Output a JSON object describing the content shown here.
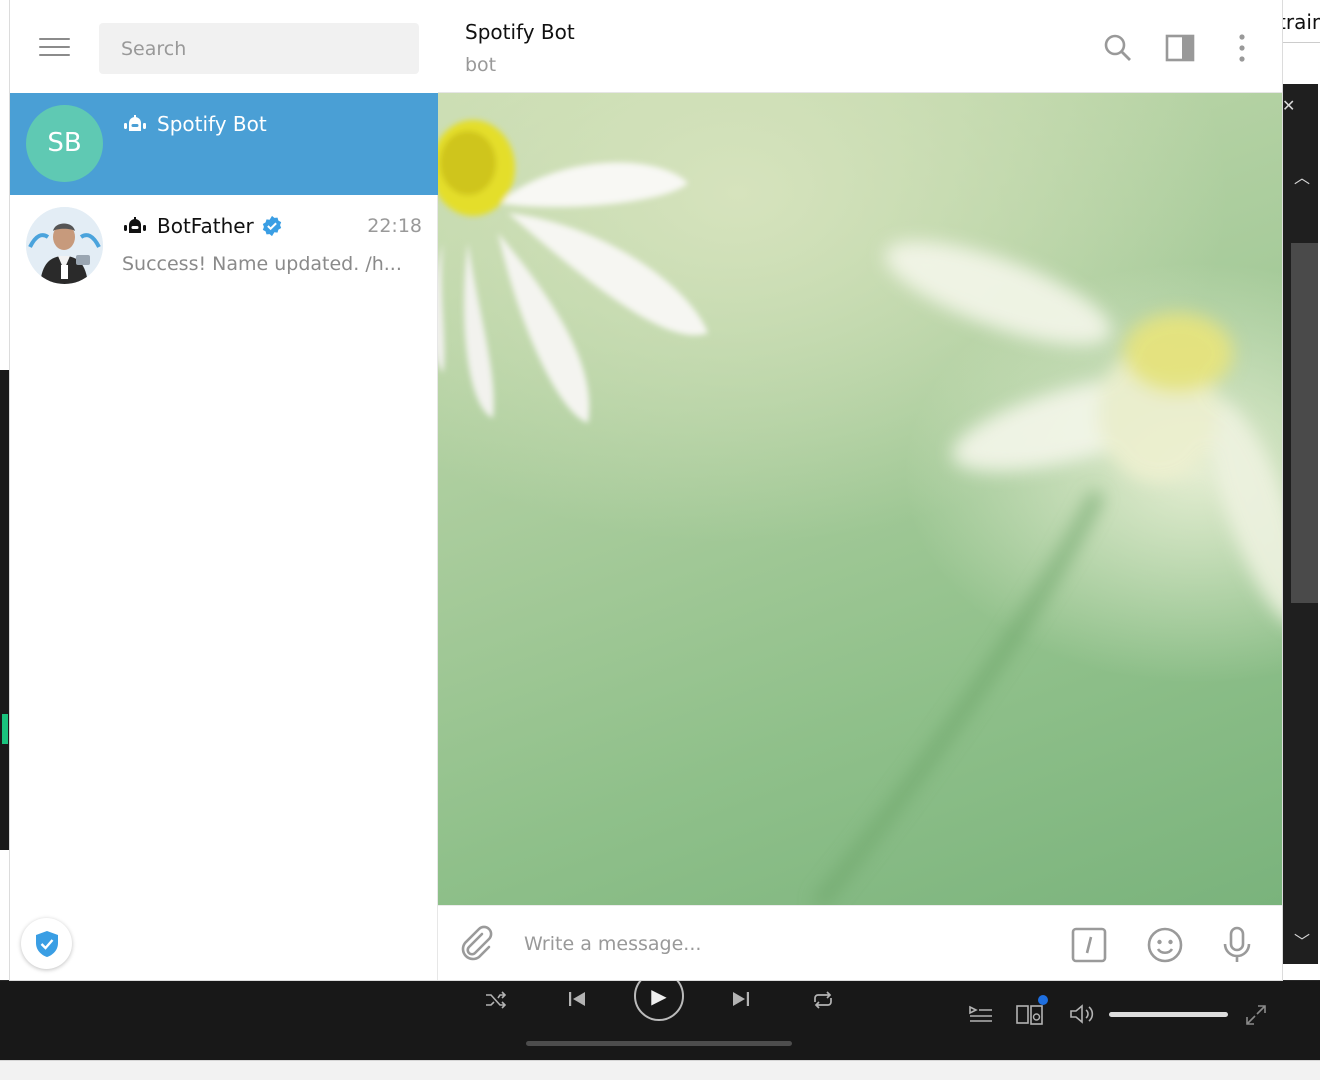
{
  "background": {
    "right_top_fragment": "train"
  },
  "telegram": {
    "sidebar": {
      "search_placeholder": "Search",
      "chats": [
        {
          "avatar_initials": "SB",
          "name": "Spotify Bot",
          "time": "",
          "preview": ""
        },
        {
          "avatar_initials": "",
          "name": "BotFather",
          "time": "22:18",
          "preview": "Success! Name updated. /h..."
        }
      ]
    },
    "header": {
      "title": "Spotify Bot",
      "subtitle": "bot"
    },
    "composer": {
      "placeholder": "Write a message..."
    }
  },
  "icons": {
    "menu": "menu-icon",
    "bot": "bot-icon",
    "verified": "verified-badge-icon",
    "search": "search-icon",
    "sidebar_toggle": "sidebar-toggle-icon",
    "more": "more-vertical-icon",
    "attach": "paperclip-icon",
    "commands": "slash-command-icon",
    "emoji": "emoji-icon",
    "mic": "microphone-icon",
    "shield": "shield-check-icon"
  },
  "colors": {
    "accent": "#4a9fd5",
    "avatar_sb": "#5fc9b3",
    "verified": "#3a9ee4",
    "player_bg": "#181818"
  }
}
